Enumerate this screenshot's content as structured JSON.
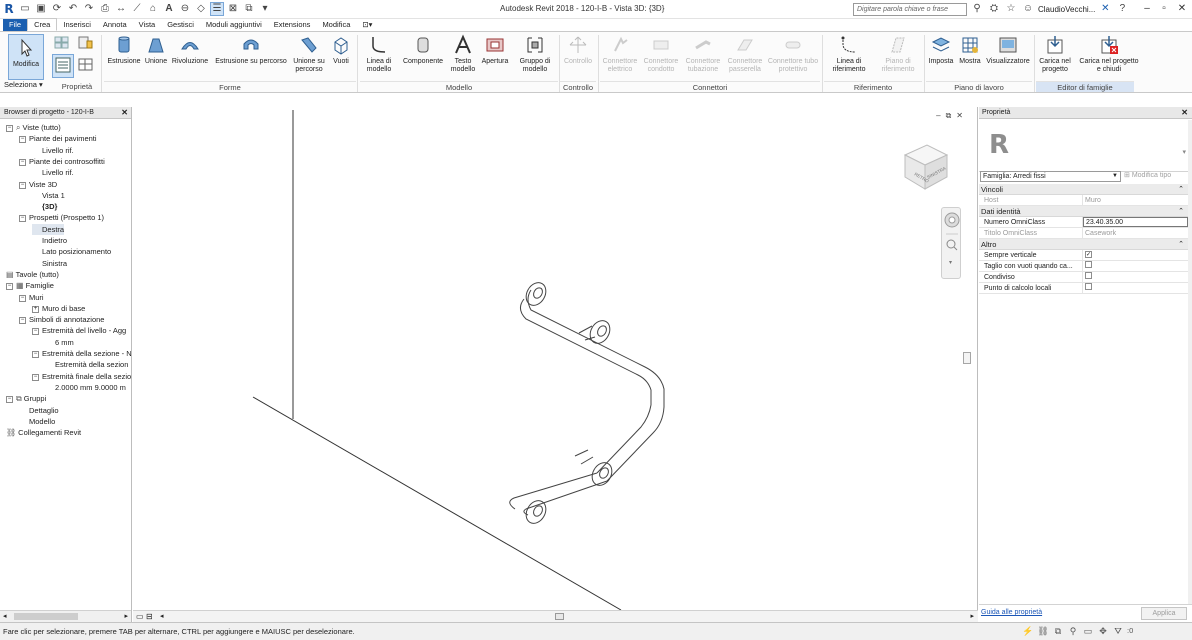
{
  "window": {
    "title": "Autodesk Revit 2018 -     120-I-B - Vista 3D: {3D}",
    "search_placeholder": "Digitare parola chiave o frase",
    "username": "ClaudioVecchi..."
  },
  "tabs": [
    "File",
    "Crea",
    "Inserisci",
    "Annota",
    "Vista",
    "Gestisci",
    "Moduli aggiuntivi",
    "Extensions",
    "Modifica"
  ],
  "active_tab": "Crea",
  "ribbon": {
    "selection": {
      "modifica": "Modifica",
      "seleziona": "Seleziona ▾",
      "proprieta": "Proprietà"
    },
    "forme": {
      "label": "Forme",
      "buttons": [
        "Estrusione",
        "Unione",
        "Rivoluzione",
        "Estrusione su percorso",
        "Unione su percorso",
        "Vuoti"
      ]
    },
    "modello": {
      "label": "Modello",
      "buttons": [
        "Linea di modello",
        "Componente",
        "Testo modello",
        "Apertura",
        "Gruppo di modello"
      ]
    },
    "controllo": {
      "label": "Controllo",
      "buttons": [
        "Controllo"
      ]
    },
    "connettori": {
      "label": "Connettori",
      "buttons": [
        "Connettore elettrico",
        "Connettore condotto",
        "Connettore tubazione",
        "Connettore passerella",
        "Connettore tubo protettivo"
      ]
    },
    "riferimento": {
      "label": "Riferimento",
      "buttons": [
        "Linea di riferimento",
        "Piano di riferimento"
      ]
    },
    "piano": {
      "label": "Piano di lavoro",
      "buttons": [
        "Imposta",
        "Mostra",
        "Visualizzatore"
      ]
    },
    "editor": {
      "label": "Editor di famiglie",
      "buttons": [
        "Carica nel progetto",
        "Carica nel progetto e chiudi"
      ]
    }
  },
  "browser": {
    "title": "Browser di progetto - 120-I-B",
    "nodes": [
      {
        "label": "Viste (tutto)",
        "depth": 0,
        "toggle": "−",
        "icon": "views"
      },
      {
        "label": "Piante dei pavimenti",
        "depth": 1,
        "toggle": "−"
      },
      {
        "label": "Livello rif.",
        "depth": 2
      },
      {
        "label": "Piante dei controsoffitti",
        "depth": 1,
        "toggle": "−"
      },
      {
        "label": "Livello rif.",
        "depth": 2
      },
      {
        "label": "Viste 3D",
        "depth": 1,
        "toggle": "−"
      },
      {
        "label": "Vista 1",
        "depth": 2
      },
      {
        "label": "{3D}",
        "depth": 2,
        "bold": true
      },
      {
        "label": "Prospetti (Prospetto 1)",
        "depth": 1,
        "toggle": "−"
      },
      {
        "label": "Destra",
        "depth": 2,
        "selected": true
      },
      {
        "label": "Indietro",
        "depth": 2
      },
      {
        "label": "Lato posizionamento",
        "depth": 2
      },
      {
        "label": "Sinistra",
        "depth": 2
      },
      {
        "label": "Tavole (tutto)",
        "depth": 0,
        "icon": "sheets"
      },
      {
        "label": "Famiglie",
        "depth": 0,
        "toggle": "−",
        "icon": "families"
      },
      {
        "label": "Muri",
        "depth": 1,
        "toggle": "−"
      },
      {
        "label": "Muro di base",
        "depth": 2,
        "toggle": "+"
      },
      {
        "label": "Simboli di annotazione",
        "depth": 1,
        "toggle": "−"
      },
      {
        "label": "Estremità del livello - Agg",
        "depth": 2,
        "toggle": "−"
      },
      {
        "label": "6 mm",
        "depth": 3
      },
      {
        "label": "Estremità della sezione - N",
        "depth": 2,
        "toggle": "−"
      },
      {
        "label": "Estremità della sezion",
        "depth": 3
      },
      {
        "label": "Estremità finale della sezio",
        "depth": 2,
        "toggle": "−"
      },
      {
        "label": "2.0000 mm 9.0000 m",
        "depth": 3
      },
      {
        "label": "Gruppi",
        "depth": 0,
        "toggle": "−",
        "icon": "groups"
      },
      {
        "label": "Dettaglio",
        "depth": 1
      },
      {
        "label": "Modello",
        "depth": 1
      },
      {
        "label": "Collegamenti Revit",
        "depth": 0,
        "icon": "links"
      }
    ]
  },
  "viewcube": {
    "left_face": "RETRO",
    "right_face": "SINISTRA"
  },
  "properties": {
    "title": "Proprietà",
    "family": "Famiglia: Arredi fissi",
    "edit_type": "Modifica tipo",
    "groups": [
      {
        "name": "Vincoli",
        "rows": [
          {
            "key": "Host",
            "value": "Muro",
            "grey": true
          }
        ]
      },
      {
        "name": "Dati identità",
        "rows": [
          {
            "key": "Numero OmniClass",
            "value": "23.40.35.00",
            "boxed": true
          },
          {
            "key": "Titolo OmniClass",
            "value": "Casework",
            "grey": true
          }
        ]
      },
      {
        "name": "Altro",
        "rows": [
          {
            "key": "Sempre verticale",
            "check": true
          },
          {
            "key": "Taglio con vuoti quando ca...",
            "check": false
          },
          {
            "key": "Condiviso",
            "check": false
          },
          {
            "key": "Punto di calcolo locali",
            "check": false
          }
        ]
      }
    ],
    "help_link": "Guida alle proprietà",
    "apply": "Applica"
  },
  "status": {
    "text": "Fare clic per selezionare, premere TAB per alternare, CTRL per aggiungere e MAIUSC per deselezionare.",
    "filter_count": ":0"
  }
}
